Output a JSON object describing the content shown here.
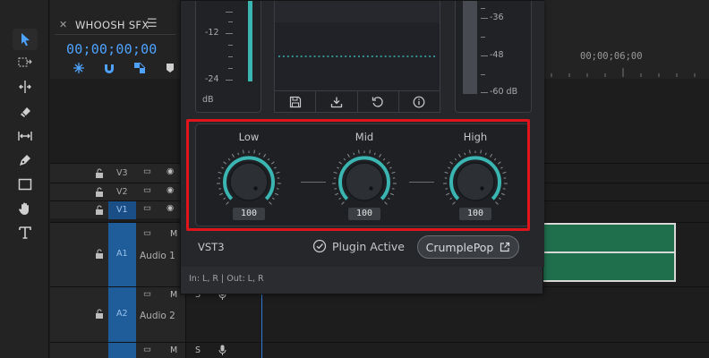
{
  "timeline": {
    "sequence_title": "WHOOSH SFX",
    "timecode": "00;00;00;00",
    "ruler_time": "00;00;06;00",
    "tracks": {
      "v3": "V3",
      "v2": "V2",
      "v1": "V1",
      "a1": "A1",
      "a1_name": "Audio 1",
      "a2": "A2",
      "a2_name": "Audio 2",
      "mute": "M",
      "solo": "S"
    }
  },
  "plugin": {
    "input_meter": {
      "labels": [
        "-12",
        "-24",
        "dB"
      ]
    },
    "output_meter": {
      "labels": [
        "-36",
        "-48",
        "-60 dB"
      ]
    },
    "eq": {
      "low": {
        "label": "Low",
        "value": "100"
      },
      "mid": {
        "label": "Mid",
        "value": "100"
      },
      "high": {
        "label": "High",
        "value": "100"
      }
    },
    "format": "VST3",
    "status": "Plugin Active",
    "brand_button": "CrumplePop",
    "io": "In: L, R | Out: L, R"
  },
  "colors": {
    "accent_teal": "#3ab5b1",
    "timecode_blue": "#4da3ff",
    "highlight_red": "#e0141b",
    "clip_green": "#1f6f4d"
  }
}
